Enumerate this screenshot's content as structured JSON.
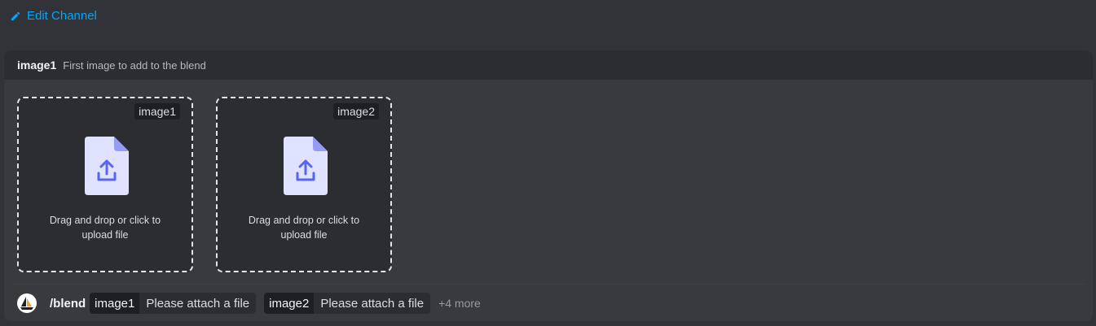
{
  "top_link": {
    "label": "Edit Channel",
    "icon": "pencil-icon"
  },
  "option_header": {
    "name": "image1",
    "description": "First image to add to the blend"
  },
  "dropzones": [
    {
      "tag": "image1",
      "text": "Drag and drop or click to upload file",
      "icon": "file-upload-icon"
    },
    {
      "tag": "image2",
      "text": "Drag and drop or click to upload file",
      "icon": "file-upload-icon"
    }
  ],
  "command": {
    "name": "/blend",
    "options": [
      {
        "key": "image1",
        "value": "Please attach a file"
      },
      {
        "key": "image2",
        "value": "Please attach a file"
      }
    ],
    "more_label": "+4 more"
  },
  "colors": {
    "accent": "#00a8fc",
    "upload_icon_bg": "#e0e3ff",
    "upload_icon_arrow": "#5865f2"
  }
}
